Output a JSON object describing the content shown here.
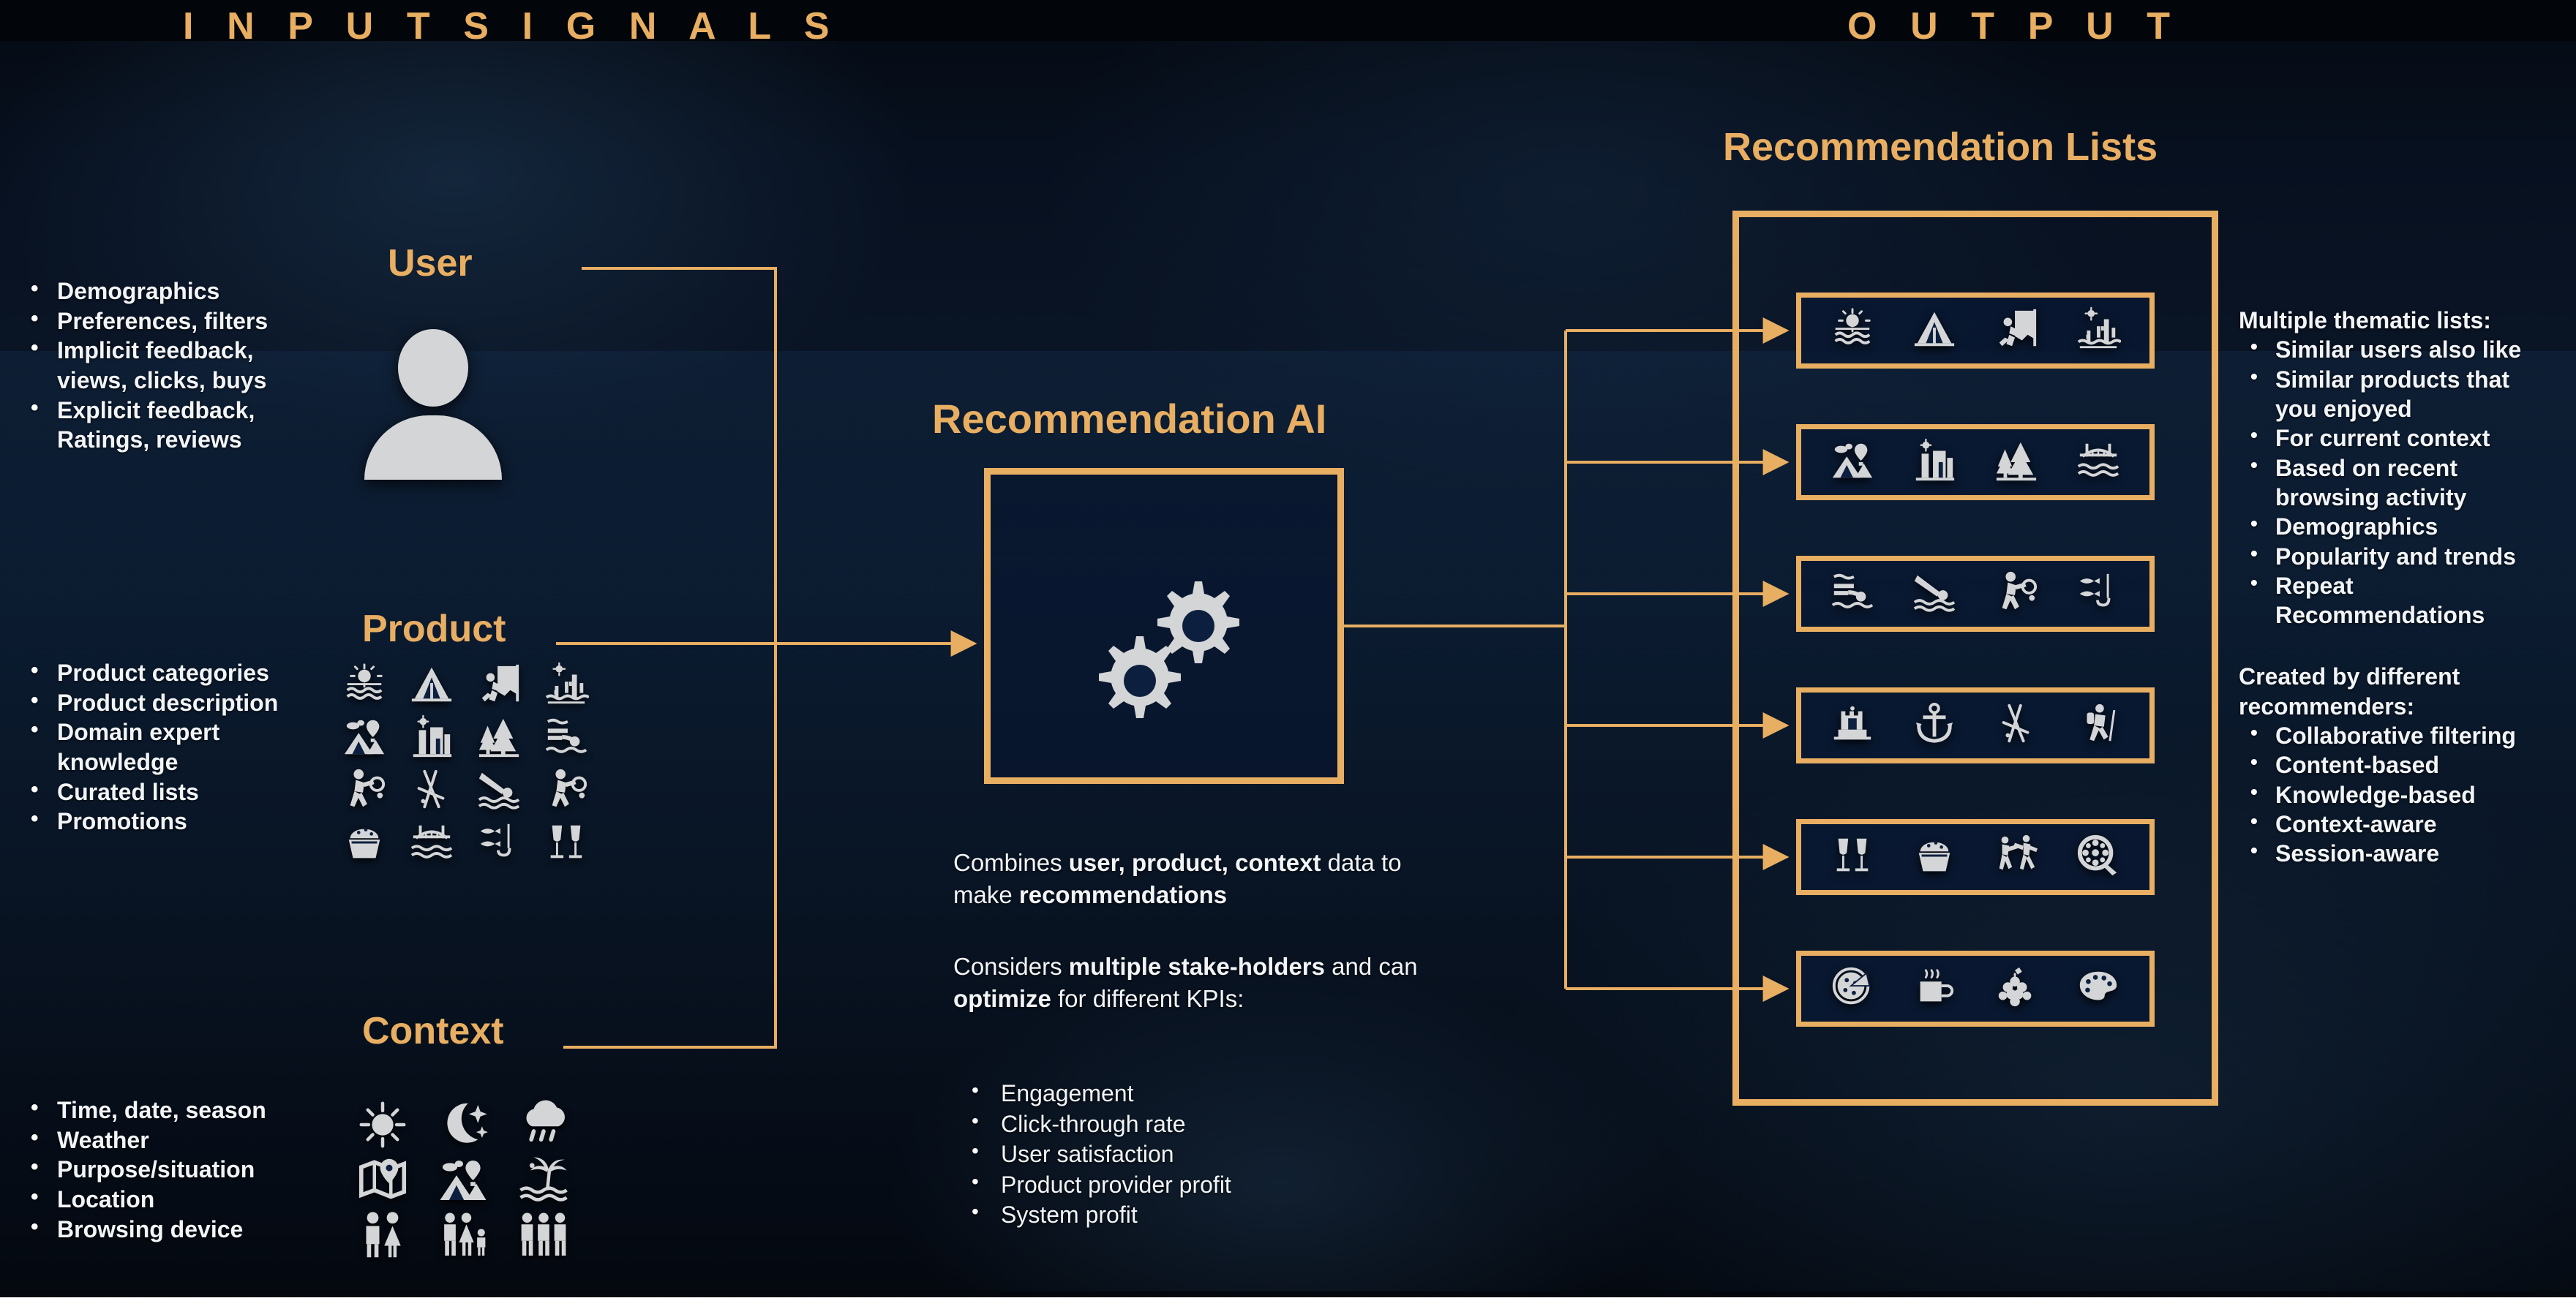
{
  "headers": {
    "input": "I N P U T   S I G N A L S",
    "output": "O U T P U T"
  },
  "colors": {
    "gold": "#E8AE62",
    "text": "#F2F5F8",
    "panel_fill": "#0C1B33",
    "background": "#07101F"
  },
  "left": {
    "user": {
      "title": "User",
      "bullets": [
        {
          "text": "Demographics",
          "cont": false
        },
        {
          "text": "Preferences, filters",
          "cont": false
        },
        {
          "text": "Implicit feedback,",
          "cont": false
        },
        {
          "text": "views, clicks, buys",
          "cont": true
        },
        {
          "text": "Explicit feedback,",
          "cont": false
        },
        {
          "text": "Ratings, reviews",
          "cont": true
        }
      ],
      "avatar_icon": "user-avatar-icon"
    },
    "product": {
      "title": "Product",
      "bullets": [
        {
          "text": "Product categories",
          "cont": false
        },
        {
          "text": "Product description",
          "cont": false
        },
        {
          "text": "Domain expert",
          "cont": false
        },
        {
          "text": "knowledge",
          "cont": true
        },
        {
          "text": "Curated lists",
          "cont": false
        },
        {
          "text": "Promotions",
          "cont": false
        }
      ],
      "icons": [
        "beach-sunset-icon",
        "tent-icon",
        "rock-climbing-icon",
        "desert-cactus-icon",
        "mountain-balloon-icon",
        "canyon-icon",
        "forest-icon",
        "water-slide-icon",
        "tennis-icon",
        "skis-icon",
        "diver-icon",
        "tennis-icon",
        "cupcake-icon",
        "bridge-icon",
        "fishing-icon",
        "champagne-icon"
      ]
    },
    "context": {
      "title": "Context",
      "bullets": [
        {
          "text": "Time, date, season",
          "cont": false
        },
        {
          "text": "Weather",
          "cont": false
        },
        {
          "text": "Purpose/situation",
          "cont": false
        },
        {
          "text": "Location",
          "cont": false
        },
        {
          "text": "Browsing device",
          "cont": false
        }
      ],
      "icons": [
        "sun-icon",
        "moon-stars-icon",
        "rain-cloud-icon",
        "map-pin-icon",
        "mountain-balloon-icon",
        "palm-beach-icon",
        "couple-icon",
        "family-icon",
        "group-icon"
      ]
    }
  },
  "center": {
    "title": "Recommendation AI",
    "box_icon": "gears-icon",
    "paragraph1": {
      "parts": [
        {
          "t": "Combines ",
          "b": false
        },
        {
          "t": "user, product, context",
          "b": true
        },
        {
          "t": " data to make ",
          "b": false
        },
        {
          "t": "recommendations",
          "b": true
        }
      ]
    },
    "paragraph2": {
      "parts": [
        {
          "t": "Considers ",
          "b": false
        },
        {
          "t": "multiple stake-holders",
          "b": true
        },
        {
          "t": " and can ",
          "b": false
        },
        {
          "t": "optimize",
          "b": true
        },
        {
          "t": " for different KPIs:",
          "b": false
        }
      ]
    },
    "kpis": [
      "Engagement",
      "Click-through rate",
      "User satisfaction",
      "Product provider profit",
      "System profit"
    ]
  },
  "output": {
    "title": "Recommendation Lists",
    "rows": [
      {
        "icons": [
          "beach-sunset-icon",
          "tent-icon",
          "rock-climbing-icon",
          "desert-cactus-icon"
        ]
      },
      {
        "icons": [
          "mountain-balloon-icon",
          "canyon-icon",
          "forest-icon",
          "bridge-icon"
        ]
      },
      {
        "icons": [
          "water-slide-icon",
          "diver-icon",
          "tennis-icon",
          "fishing-icon"
        ]
      },
      {
        "icons": [
          "castle-icon",
          "anchor-icon",
          "skis-icon",
          "hiker-icon"
        ]
      },
      {
        "icons": [
          "champagne-icon",
          "cupcake-icon",
          "dancing-icon",
          "film-reel-icon"
        ]
      },
      {
        "icons": [
          "pizza-icon",
          "coffee-icon",
          "grapes-icon",
          "palette-icon"
        ]
      }
    ],
    "thematic_lead": "Multiple thematic lists:",
    "thematic": [
      {
        "text": "Similar users also like",
        "cont": false
      },
      {
        "text": "Similar products that",
        "cont": false
      },
      {
        "text": "you enjoyed",
        "cont": true
      },
      {
        "text": "For current context",
        "cont": false
      },
      {
        "text": "Based on recent",
        "cont": false
      },
      {
        "text": "browsing activity",
        "cont": true
      },
      {
        "text": "Demographics",
        "cont": false
      },
      {
        "text": "Popularity and trends",
        "cont": false
      },
      {
        "text": "Repeat",
        "cont": false
      },
      {
        "text": "Recommendations",
        "cont": true
      }
    ],
    "recommenders_lead_1": "Created by different",
    "recommenders_lead_2": "recommenders:",
    "recommenders": [
      {
        "text": "Collaborative filtering",
        "cont": false
      },
      {
        "text": "Content-based",
        "cont": false
      },
      {
        "text": "Knowledge-based",
        "cont": false
      },
      {
        "text": "Context-aware",
        "cont": false
      },
      {
        "text": "Session-aware",
        "cont": false
      }
    ]
  }
}
